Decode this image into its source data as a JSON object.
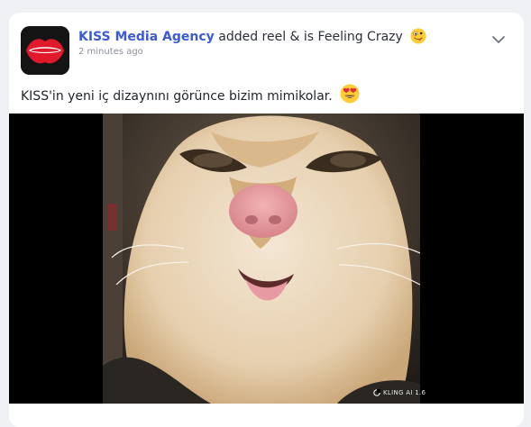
{
  "post": {
    "author": "KISS Media Agency",
    "action": "added reel & is Feeling Crazy",
    "feeling_emoji": "zany-face-emoji",
    "timestamp": "2 minutes ago",
    "caption": "KISS'in yeni iç dizaynını görünce bizim mimikolar.",
    "caption_emoji": "heart-eyes-emoji",
    "avatar_logo_text": "KISS"
  },
  "media": {
    "subject": "cat-closeup",
    "watermark": "KLING AI 1.6"
  },
  "colors": {
    "author_link": "#3b5bd6",
    "card_bg": "#ffffff",
    "page_bg": "#eef0f4",
    "media_bg": "#000000"
  }
}
